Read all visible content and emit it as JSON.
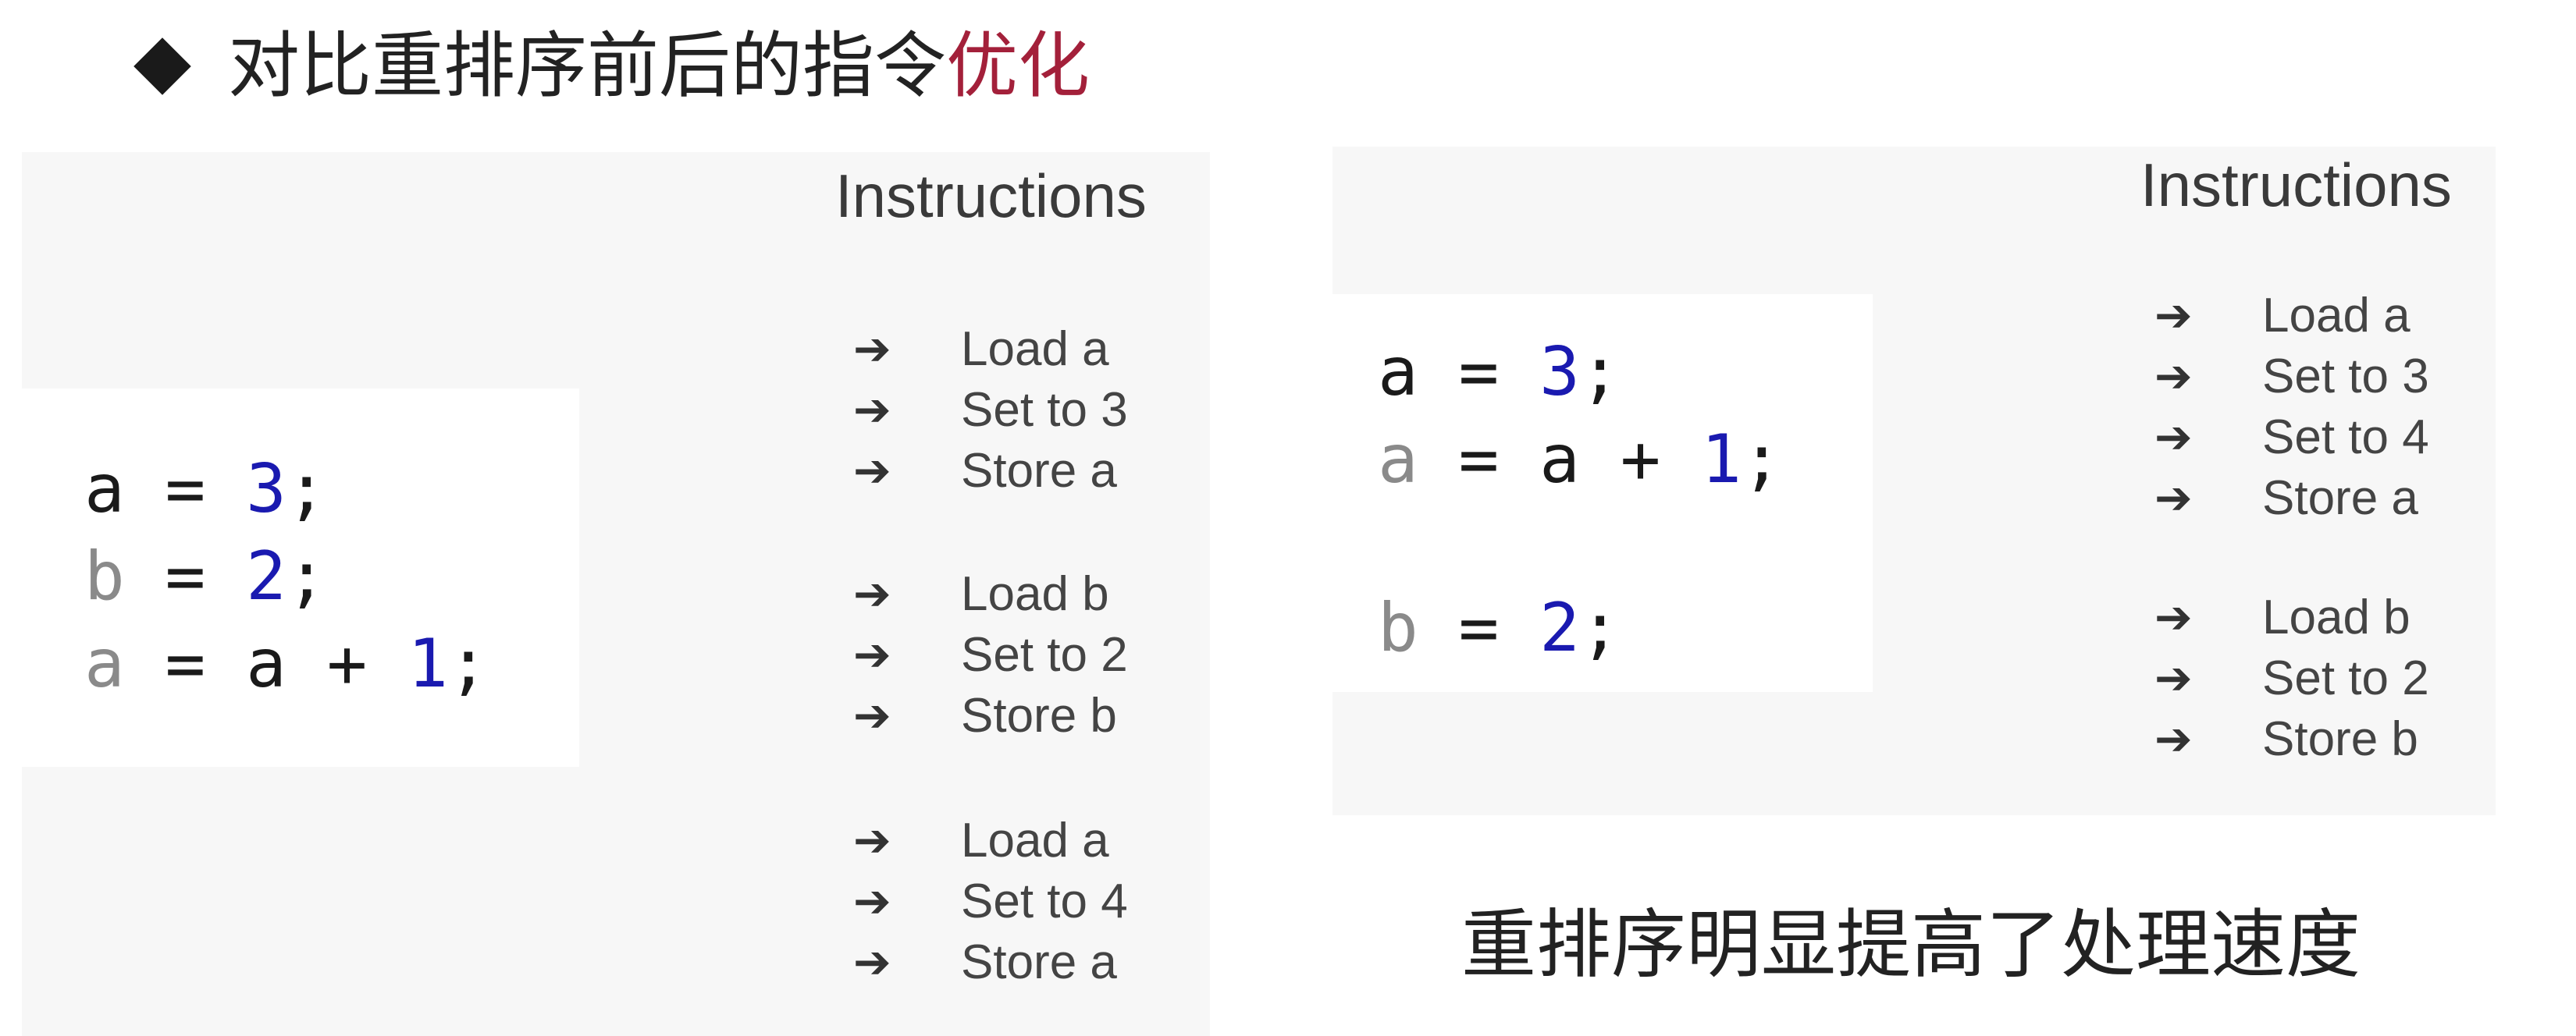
{
  "heading": {
    "text": "对比重排序前后的指令",
    "accent": "优化"
  },
  "left": {
    "code": [
      {
        "var": "a",
        "var_dim": false,
        "parts": [
          " = ",
          "3",
          ";"
        ]
      },
      {
        "var": "b",
        "var_dim": true,
        "parts": [
          " = ",
          "2",
          ";"
        ]
      },
      {
        "var": "a",
        "var_dim": true,
        "parts": [
          " = a + ",
          "1",
          ";"
        ]
      }
    ],
    "instructions_title": "Instructions",
    "groups": [
      [
        "Load a",
        "Set to 3",
        "Store a"
      ],
      [
        "Load b",
        "Set to 2",
        "Store b"
      ],
      [
        "Load a",
        "Set to 4",
        "Store a"
      ]
    ]
  },
  "right": {
    "code": [
      {
        "var": "a",
        "var_dim": false,
        "parts": [
          " = ",
          "3",
          ";"
        ]
      },
      {
        "var": "a",
        "var_dim": true,
        "parts": [
          " = a + ",
          "1",
          ";"
        ]
      },
      {
        "var": "b",
        "var_dim": true,
        "parts": [
          " = ",
          "2",
          ";"
        ]
      }
    ],
    "instructions_title": "Instructions",
    "groups": [
      [
        "Load a",
        "Set to 3",
        "Set to 4",
        "Store a"
      ],
      [
        "Load b",
        "Set to 2",
        "Store b"
      ]
    ]
  },
  "caption": "重排序明显提高了处理速度",
  "arrow_glyph": "➔",
  "colors": {
    "accent": "#a3203a",
    "number": "#1a1ab0",
    "dim_var": "#8a8a8a"
  }
}
